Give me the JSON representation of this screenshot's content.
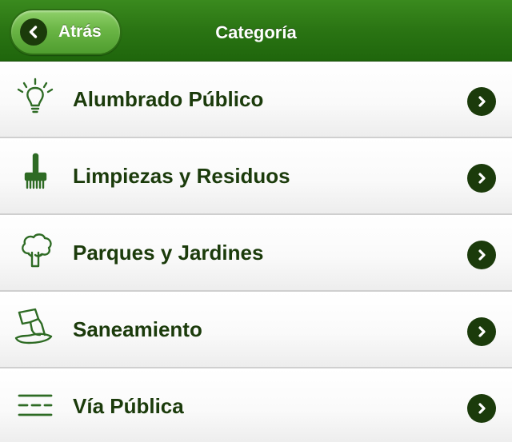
{
  "header": {
    "back_label": "Atrás",
    "title": "Categoría"
  },
  "items": [
    {
      "label": "Alumbrado Público",
      "icon": "light-bulb-icon"
    },
    {
      "label": "Limpiezas y Residuos",
      "icon": "broom-icon"
    },
    {
      "label": "Parques y Jardines",
      "icon": "tree-icon"
    },
    {
      "label": "Saneamiento",
      "icon": "sewer-icon"
    },
    {
      "label": "Vía Pública",
      "icon": "road-icon"
    }
  ],
  "colors": {
    "header_green": "#2a7413",
    "button_green": "#6ab545",
    "text_dark_green": "#1b3b0b",
    "icon_green": "#2e6b24"
  }
}
